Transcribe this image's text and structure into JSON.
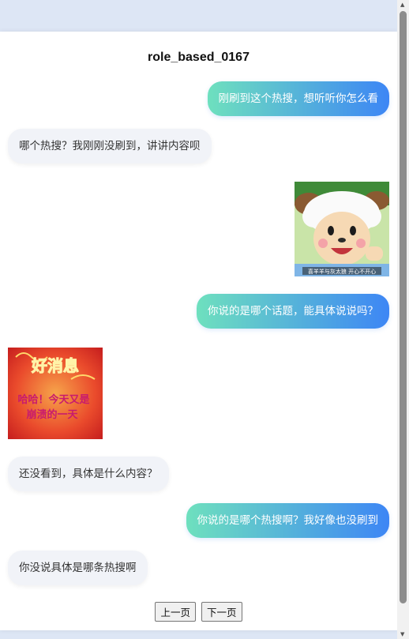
{
  "chat": {
    "title": "role_based_0167",
    "messages": [
      {
        "role": "user",
        "text": "刚刷到这个热搜，想听听你怎么看"
      },
      {
        "role": "bot",
        "text": "哪个热搜？我刚刚没刷到，讲讲内容呗"
      },
      {
        "role": "user",
        "sticker": "cartoon-sheep-sticker",
        "caption": "喜羊羊与灰太狼 开心不开心"
      },
      {
        "role": "user",
        "text": "你说的是哪个话题，能具体说说吗？"
      },
      {
        "role": "bot",
        "sticker": "good-news-sticker",
        "banner": "好消息",
        "caption_line1": "哈哈！今天又是",
        "caption_line2": "崩溃的一天"
      },
      {
        "role": "bot",
        "text": "还没看到，具体是什么内容？"
      },
      {
        "role": "user",
        "text": "你说的是哪个热搜啊？我好像也没刷到"
      },
      {
        "role": "bot",
        "text": "你没说具体是哪条热搜啊"
      }
    ]
  },
  "pager": {
    "prev_label": "上一页",
    "next_label": "下一页"
  },
  "colors": {
    "user_gradient_start": "#6ee0be",
    "user_gradient_end": "#3d86f5",
    "bot_bubble": "#f1f3f8",
    "page_bg": "#dde6f5"
  }
}
